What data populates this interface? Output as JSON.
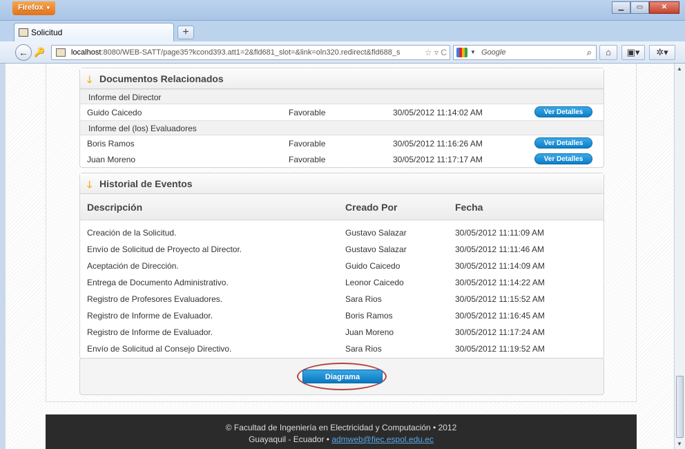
{
  "browser": {
    "menu_label": "Firefox",
    "tab_title": "Solicitud",
    "new_tab": "+",
    "url_host": "localhost",
    "url_rest": ":8080/WEB-SATT/page35?kcond393.att1=2&fld681_slot=&link=oln320.redirect&fld688_s",
    "search_engine": "Google"
  },
  "documents": {
    "title": "Documentos Relacionados",
    "groups": [
      {
        "heading": "Informe del Director",
        "rows": [
          {
            "name": "Guido Caicedo",
            "status": "Favorable",
            "date": "30/05/2012 11:14:02 AM",
            "action": "Ver Detalles"
          }
        ]
      },
      {
        "heading": "Informe del (los) Evaluadores",
        "rows": [
          {
            "name": "Boris Ramos",
            "status": "Favorable",
            "date": "30/05/2012 11:16:26 AM",
            "action": "Ver Detalles"
          },
          {
            "name": "Juan Moreno",
            "status": "Favorable",
            "date": "30/05/2012 11:17:17 AM",
            "action": "Ver Detalles"
          }
        ]
      }
    ]
  },
  "events": {
    "title": "Historial de Eventos",
    "columns": [
      "Descripción",
      "Creado Por",
      "Fecha"
    ],
    "rows": [
      [
        "Creación de la Solicitud.",
        "Gustavo Salazar",
        "30/05/2012 11:11:09 AM"
      ],
      [
        "Envío de Solicitud de Proyecto al Director.",
        "Gustavo Salazar",
        "30/05/2012 11:11:46 AM"
      ],
      [
        "Aceptación de Dirección.",
        "Guido Caicedo",
        "30/05/2012 11:14:09 AM"
      ],
      [
        "Entrega de Documento Administrativo.",
        "Leonor Caicedo",
        "30/05/2012 11:14:22 AM"
      ],
      [
        "Registro de Profesores Evaluadores.",
        "Sara Rios",
        "30/05/2012 11:15:52 AM"
      ],
      [
        "Registro de Informe de Evaluador.",
        "Boris Ramos",
        "30/05/2012 11:16:45 AM"
      ],
      [
        "Registro de Informe de Evaluador.",
        "Juan Moreno",
        "30/05/2012 11:17:24 AM"
      ],
      [
        "Envío de Solicitud al Consejo Directivo.",
        "Sara Rios",
        "30/05/2012 11:19:52 AM"
      ]
    ]
  },
  "diagram_button": "Diagrama",
  "footer": {
    "line1": "© Facultad de Ingeniería en Electricidad y Computación • 2012",
    "line2_prefix": "Guayaquil - Ecuador • ",
    "email": "admweb@fiec.espol.edu.ec"
  },
  "colors": {
    "accent": "#1a8fd6",
    "highlight_ring": "#b3423f",
    "footer_bg": "#2b2b2b"
  }
}
